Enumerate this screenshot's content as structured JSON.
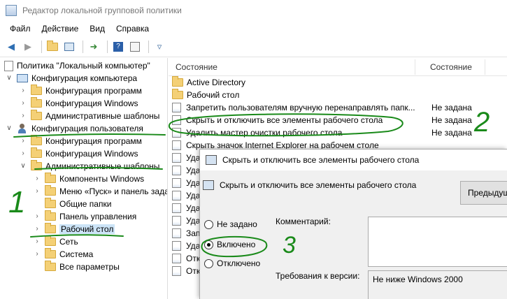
{
  "window": {
    "title": "Редактор локальной групповой политики"
  },
  "menu": [
    "Файл",
    "Действие",
    "Вид",
    "Справка"
  ],
  "toolbar": [
    "back-icon",
    "forward-icon",
    "up-folder-icon",
    "show-hide-tree-icon",
    "export-icon",
    "help-icon",
    "properties-icon",
    "filter-icon"
  ],
  "tree": {
    "root": "Политика \"Локальный компьютер\"",
    "computer_config": "Конфигурация компьютера",
    "cc_programs": "Конфигурация программ",
    "cc_windows": "Конфигурация Windows",
    "cc_admin": "Административные шаблоны",
    "user_config": "Конфигурация пользователя",
    "uc_programs": "Конфигурация программ",
    "uc_windows": "Конфигурация Windows",
    "uc_admin": "Административные шаблоны",
    "admin_children": [
      "Компоненты Windows",
      "Меню «Пуск» и панель задач",
      "Общие папки",
      "Панель управления",
      "Рабочий стол",
      "Сеть",
      "Система",
      "Все параметры"
    ]
  },
  "list": {
    "col_name": "Состояние",
    "col_state": "Состояние",
    "folders": [
      "Active Directory",
      "Рабочий стол"
    ],
    "settings": [
      {
        "name": "Запретить пользователям вручную перенаправлять папк...",
        "state": "Не задана"
      },
      {
        "name": "Скрыть и отключить все элементы рабочего стола",
        "state": "Не задана"
      },
      {
        "name": "Удалить мастер очистки рабочего стола",
        "state": "Не задана"
      },
      {
        "name": "Скрыть значок Internet Explorer на рабочем столе",
        "state": ""
      },
      {
        "name": "Уда",
        "state": ""
      },
      {
        "name": "Уда",
        "state": ""
      },
      {
        "name": "Уда",
        "state": ""
      },
      {
        "name": "Уда",
        "state": ""
      },
      {
        "name": "Уда",
        "state": ""
      },
      {
        "name": "Уда",
        "state": ""
      },
      {
        "name": "Зап",
        "state": ""
      },
      {
        "name": "Уда",
        "state": ""
      },
      {
        "name": "Отк",
        "state": ""
      },
      {
        "name": "Отк",
        "state": ""
      }
    ]
  },
  "dialog": {
    "title": "Скрыть и отключить все элементы рабочего стола",
    "header": "Скрыть и отключить все элементы рабочего стола",
    "prev_button": "Предыдущ",
    "options": {
      "not_set": "Не задано",
      "enabled": "Включено",
      "disabled": "Отключено"
    },
    "selected": "enabled",
    "comment_label": "Комментарий:",
    "requirements_label": "Требования к версии:",
    "requirements_value": "Не ниже Windows 2000"
  },
  "annotations": {
    "step1": "1",
    "step2": "2",
    "step3": "3",
    "color": "#1a8a1a"
  }
}
